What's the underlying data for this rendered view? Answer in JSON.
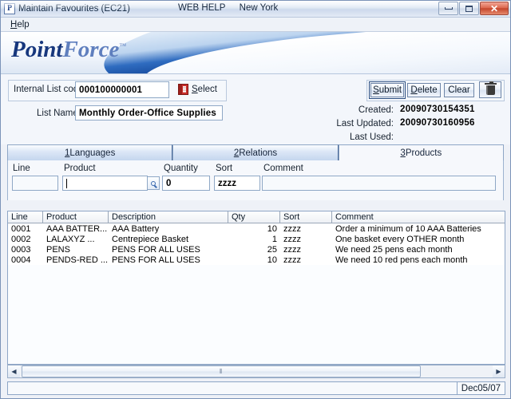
{
  "window": {
    "icon": "pointforce-app-icon",
    "icon_letter": "P",
    "title": "Maintain Favourites (EC21)",
    "web_help": "WEB HELP",
    "location": "New York",
    "minimize": "minimize-icon",
    "maximize": "maximize-icon",
    "close": "✕"
  },
  "menubar": {
    "help_accel": "H",
    "help_rest": "elp"
  },
  "banner": {
    "logo_part1": "Point",
    "logo_part2": "Force",
    "trademark": "™"
  },
  "form": {
    "list_code_label": "Internal List code",
    "list_code_value": "000100000001",
    "select_label_accel": "S",
    "select_label_rest": "elect",
    "select_icon": "book-icon",
    "nav": [
      {
        "name": "first",
        "glyph": "◀◀"
      },
      {
        "name": "previous",
        "glyph": "◀"
      },
      {
        "name": "next",
        "glyph": "▶"
      },
      {
        "name": "last",
        "glyph": "▶▶"
      }
    ],
    "list_name_label": "List Name",
    "list_name_value": "Monthly Order-Office Supplies",
    "buttons": [
      {
        "accel": "S",
        "rest": "ubmit",
        "focused": true
      },
      {
        "accel": "D",
        "rest": "elete",
        "focused": false
      },
      {
        "accel": "",
        "rest": "Clear",
        "focused": false
      }
    ],
    "delete_icon": "trash-icon",
    "meta": [
      {
        "label": "Created:",
        "value": "20090730154351"
      },
      {
        "label": "Last Updated:",
        "value": "20090730160956"
      },
      {
        "label": "Last Used:",
        "value": ""
      }
    ]
  },
  "tabs": [
    {
      "accel": "1",
      "label": " Languages",
      "active": false
    },
    {
      "accel": "2",
      "label": " Relations",
      "active": false
    },
    {
      "accel": "3",
      "label": " Products",
      "active": true
    }
  ],
  "entry": {
    "fields": [
      {
        "label": "Line",
        "value": ""
      },
      {
        "label": "Product",
        "value": ""
      },
      {
        "label": "Quantity",
        "value": "0"
      },
      {
        "label": "Sort",
        "value": "zzzz"
      },
      {
        "label": "Comment",
        "value": ""
      }
    ],
    "lookup_icon": "magnifier-icon"
  },
  "grid": {
    "columns": [
      "Line",
      "Product",
      "Description",
      "Qty",
      "Sort",
      "Comment"
    ],
    "rows": [
      {
        "line": "0001",
        "product": "AAA BATTER...",
        "description": "AAA Battery",
        "qty": "10",
        "sort": "zzzz",
        "comment": "Order a minimum of 10 AAA Batteries"
      },
      {
        "line": "0002",
        "product": "LALAXYZ      ...",
        "description": "Centrepiece Basket",
        "qty": "1",
        "sort": "zzzz",
        "comment": "One basket every OTHER month"
      },
      {
        "line": "0003",
        "product": "PENS",
        "description": "PENS FOR ALL USES",
        "qty": "25",
        "sort": "zzzz",
        "comment": "We need 25 pens each month"
      },
      {
        "line": "0004",
        "product": "PENDS-RED  ...",
        "description": "PENS FOR ALL USES",
        "qty": "10",
        "sort": "zzzz",
        "comment": "We need 10 red pens each month"
      }
    ]
  },
  "scrollbar": {
    "left_arrow": "◀",
    "right_arrow": "▶",
    "grip": "⦀"
  },
  "statusbar": {
    "date": "Dec05/07"
  },
  "colors": {
    "accent_blue": "#17377d",
    "logo_light": "#5f7fbe",
    "close_red": "#c4462c",
    "select_icon_red": "#9e1f1b"
  }
}
